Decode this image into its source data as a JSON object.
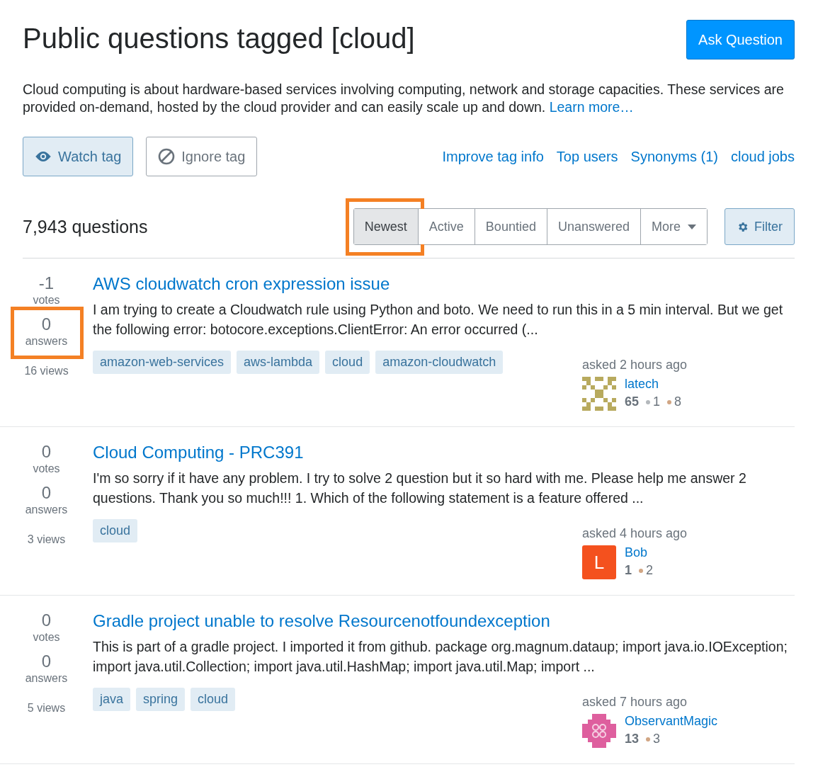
{
  "header": {
    "title": "Public questions tagged [cloud]",
    "ask_button": "Ask Question"
  },
  "description": {
    "text": "Cloud computing is about hardware-based services involving computing, network and storage capacities. These services are provided on-demand, hosted by the cloud provider and can easily scale up and down.",
    "link": "Learn more…"
  },
  "tag_actions": [
    {
      "kind": "watch",
      "label": "Watch tag",
      "selected": true
    },
    {
      "kind": "ignore",
      "label": "Ignore tag",
      "selected": false
    }
  ],
  "tag_links": [
    "Improve tag info",
    "Top users",
    "Synonyms (1)",
    "cloud jobs"
  ],
  "question_count": "7,943 questions",
  "sort_tabs": [
    {
      "label": "Newest",
      "selected": true,
      "highlighted": true,
      "dropdown": false
    },
    {
      "label": "Active",
      "selected": false,
      "highlighted": false,
      "dropdown": false
    },
    {
      "label": "Bountied",
      "selected": false,
      "highlighted": false,
      "dropdown": false
    },
    {
      "label": "Unanswered",
      "selected": false,
      "highlighted": false,
      "dropdown": false
    },
    {
      "label": "More",
      "selected": false,
      "highlighted": false,
      "dropdown": true
    }
  ],
  "filter_button": "Filter",
  "questions": [
    {
      "votes": "-1",
      "votes_label": "votes",
      "answers": "0",
      "answers_label": "answers",
      "answers_highlighted": true,
      "views": "16 views",
      "title": "AWS cloudwatch cron expression issue",
      "excerpt": "I am trying to create a Cloudwatch rule using Python and boto. We need to run this in a 5 min interval. But we get the following error: botocore.exceptions.ClientError: An error occurred (...",
      "tags": [
        "amazon-web-services",
        "aws-lambda",
        "cloud",
        "amazon-cloudwatch"
      ],
      "asked": "asked 2 hours ago",
      "user": {
        "name": "latech",
        "reputation": "65",
        "avatar": {
          "kind": "identicon",
          "color": "#b8aa5e"
        },
        "badges": [
          {
            "kind": "silver",
            "count": "1"
          },
          {
            "kind": "bronze",
            "count": "8"
          }
        ]
      }
    },
    {
      "votes": "0",
      "votes_label": "votes",
      "answers": "0",
      "answers_label": "answers",
      "answers_highlighted": false,
      "views": "3 views",
      "title": "Cloud Computing - PRC391",
      "excerpt": "I'm so sorry if it have any problem. I try to solve 2 question but it so hard with me. Please help me answer 2 questions. Thank you so much!!! 1. Which of the following statement is a feature offered ...",
      "tags": [
        "cloud"
      ],
      "asked": "asked 4 hours ago",
      "user": {
        "name": "Bob",
        "reputation": "1",
        "avatar": {
          "kind": "letter",
          "letter": "L",
          "color": "#f4511e"
        },
        "badges": [
          {
            "kind": "bronze",
            "count": "2"
          }
        ]
      }
    },
    {
      "votes": "0",
      "votes_label": "votes",
      "answers": "0",
      "answers_label": "answers",
      "answers_highlighted": false,
      "views": "5 views",
      "title": "Gradle project unable to resolve Resourcenotfoundexception",
      "excerpt": "This is part of a gradle project. I imported it from github. package org.magnum.dataup; import java.io.IOException; import java.util.Collection; import java.util.HashMap; import java.util.Map; import ...",
      "tags": [
        "java",
        "spring",
        "cloud"
      ],
      "asked": "asked 7 hours ago",
      "user": {
        "name": "ObservantMagic",
        "reputation": "13",
        "avatar": {
          "kind": "pattern",
          "color": "#de5f9e"
        },
        "badges": [
          {
            "kind": "bronze",
            "count": "3"
          }
        ]
      }
    }
  ]
}
